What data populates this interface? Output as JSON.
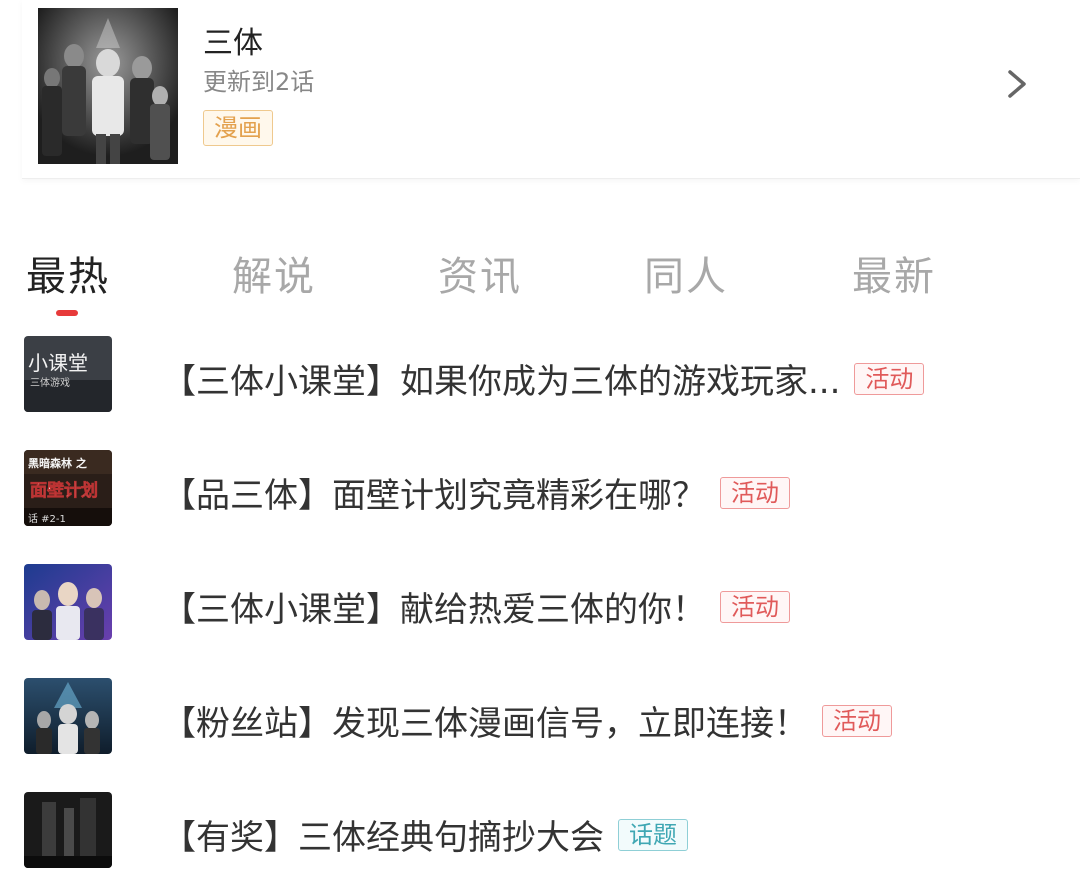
{
  "comic": {
    "title": "三体",
    "update": "更新到2话",
    "tag": "漫画"
  },
  "tabs": [
    {
      "label": "最热",
      "active": true
    },
    {
      "label": "解说",
      "active": false
    },
    {
      "label": "资讯",
      "active": false
    },
    {
      "label": "同人",
      "active": false
    },
    {
      "label": "最新",
      "active": false
    }
  ],
  "posts": [
    {
      "title": "【三体小课堂】如果你成为三体的游戏玩家...",
      "tag": "活动",
      "thumb_text": "小课堂",
      "thumb_sub": "三体游戏"
    },
    {
      "title": "【品三体】面壁计划究竟精彩在哪？",
      "tag": "活动",
      "thumb_text": "黑暗森林 之",
      "thumb_sub": "面壁计划",
      "thumb_foot": "话 #2-1"
    },
    {
      "title": "【三体小课堂】献给热爱三体的你！",
      "tag": "活动"
    },
    {
      "title": "【粉丝站】发现三体漫画信号，立即连接！",
      "tag": "活动"
    },
    {
      "title": "【有奖】三体经典句摘抄大会",
      "tag": "话题"
    }
  ],
  "colors": {
    "accent": "#e73a3a",
    "activity_tag": "#e05a5a",
    "topic_tag": "#3fa7b3",
    "comic_tag": "#e3a14e"
  }
}
